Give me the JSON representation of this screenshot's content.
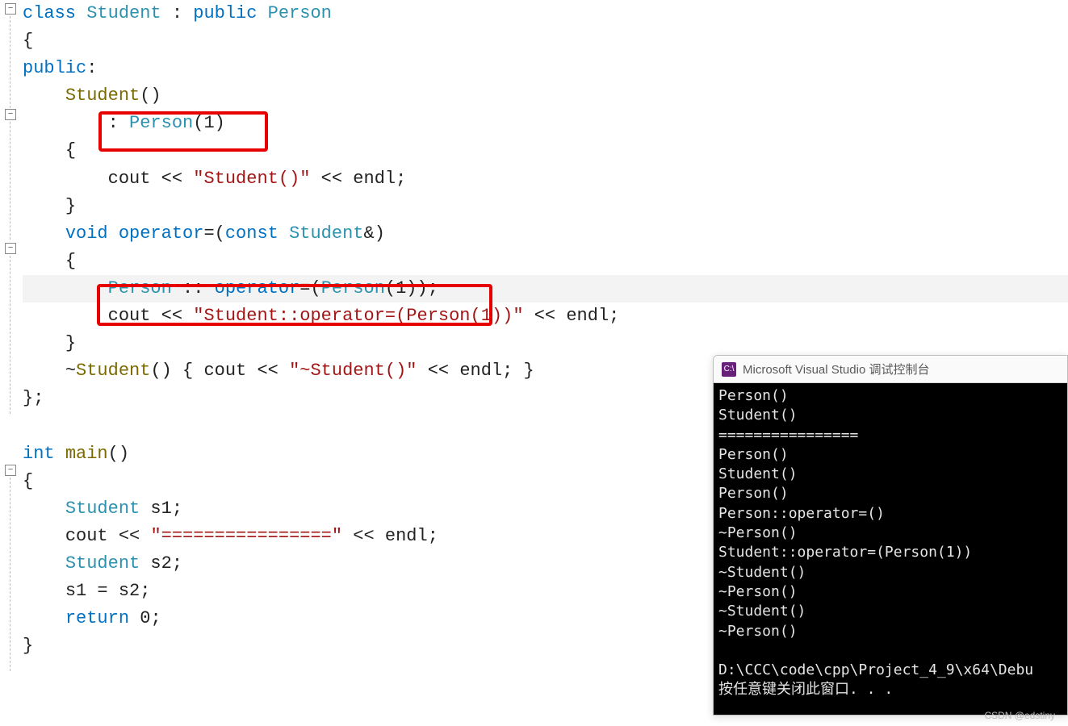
{
  "code": {
    "l01_class": "class",
    "l01_student": "Student",
    "l01_colon": " : ",
    "l01_public": "public",
    "l01_person": "Person",
    "l02_brace": "{",
    "l03_public": "public",
    "l03_colon": ":",
    "l04_student": "Student",
    "l04_parens": "()",
    "l05_init": ": ",
    "l05_person": "Person",
    "l05_args": "(1)",
    "l06_brace": "{",
    "l07_cout": "cout",
    "l07_ins": " << ",
    "l07_str": "\"Student()\"",
    "l07_ins2": " << ",
    "l07_endl": "endl",
    "l07_semi": ";",
    "l08_brace": "}",
    "l09_void": "void",
    "l09_operator": "operator",
    "l09_eq": "=(",
    "l09_const": "const",
    "l09_student": "Student",
    "l09_amp": "&)",
    "l10_brace": "{",
    "l11_person": "Person",
    "l11_scope": " :: ",
    "l11_operator": "operator",
    "l11_eq": "=(",
    "l11_personctor": "Person",
    "l11_args": "(1));",
    "l12_cout": "cout",
    "l12_ins": " << ",
    "l12_str": "\"Student::operator=(Person(1))\"",
    "l12_ins2": " << ",
    "l12_endl": "endl",
    "l12_semi": ";",
    "l13_brace": "}",
    "l14_tilde": "~",
    "l14_student": "Student",
    "l14_parens": "() { ",
    "l14_cout": "cout",
    "l14_ins": " << ",
    "l14_str": "\"~Student()\"",
    "l14_ins2": " << ",
    "l14_endl": "endl",
    "l14_rest": "; }",
    "l15_close": "};",
    "l17_int": "int",
    "l17_main": "main",
    "l17_parens": "()",
    "l18_brace": "{",
    "l19_student": "Student",
    "l19_s1": " s1;",
    "l20_cout": "cout",
    "l20_ins": " << ",
    "l20_str": "\"================\"",
    "l20_ins2": " << ",
    "l20_endl": "endl",
    "l20_semi": ";",
    "l21_student": "Student",
    "l21_s2": " s2;",
    "l22_assign": "s1 = s2;",
    "l23_return": "return",
    "l23_zero": " 0",
    "l23_semi": ";",
    "l24_brace": "}"
  },
  "console": {
    "icon_text": "C:\\",
    "title": "Microsoft Visual Studio 调试控制台",
    "lines": [
      "Person()",
      "Student()",
      "================",
      "Person()",
      "Student()",
      "Person()",
      "Person::operator=()",
      "~Person()",
      "Student::operator=(Person(1))",
      "~Student()",
      "~Person()",
      "~Student()",
      "~Person()",
      "",
      "D:\\CCC\\code\\cpp\\Project_4_9\\x64\\Debu",
      "按任意键关闭此窗口. . ."
    ]
  },
  "watermark": "CSDN @edstiny"
}
